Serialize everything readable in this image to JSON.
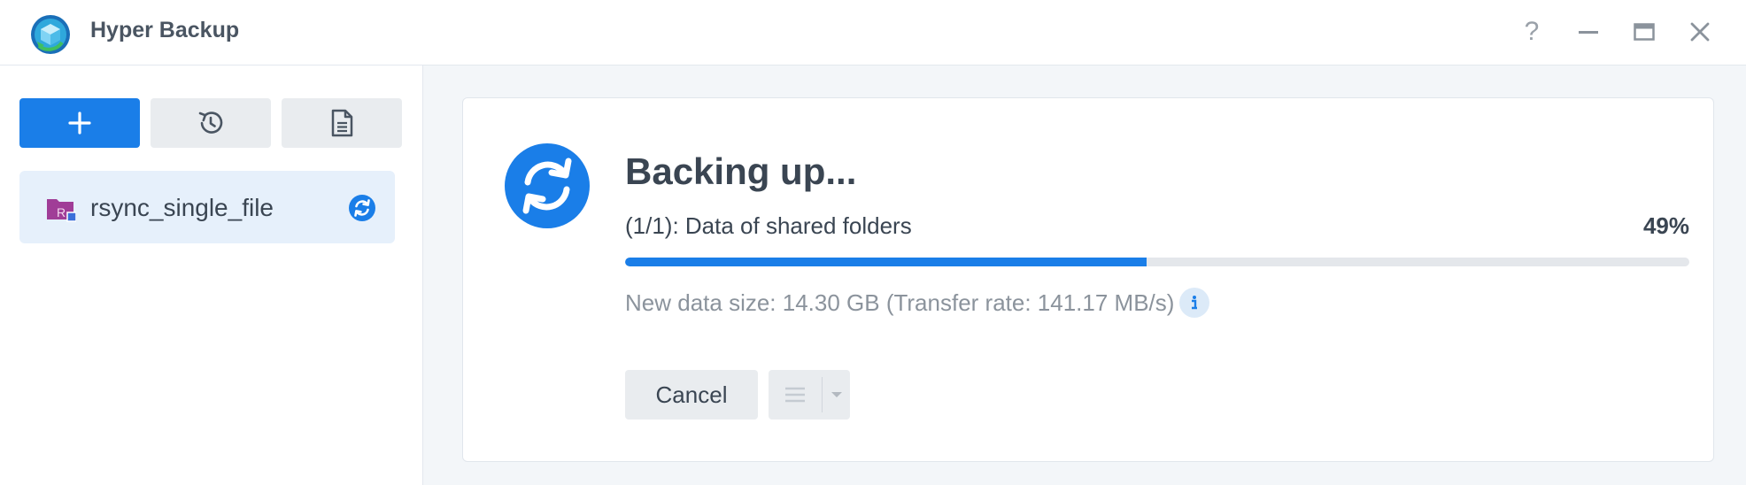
{
  "window": {
    "title": "Hyper Backup",
    "help_label": "?"
  },
  "icons": {
    "app": "hyper-backup-logo-icon",
    "add": "plus-icon",
    "history": "restore-history-icon",
    "log": "log-document-icon",
    "task": "rsync-folder-icon",
    "task_status": "sync-running-icon",
    "status": "sync-arrows-icon",
    "info": "info-icon",
    "menu": "list-menu-icon",
    "caret": "caret-down-icon",
    "minimize": "minimize-icon",
    "maximize": "maximize-icon",
    "close": "close-icon"
  },
  "colors": {
    "accent": "#1a7ee8",
    "task_folder": "#a03d97"
  },
  "sidebar": {
    "tasks": [
      {
        "label": "rsync_single_file",
        "status": "backing-up"
      }
    ]
  },
  "main": {
    "heading": "Backing up...",
    "step": "(1/1): Data of shared folders",
    "percent_label": "49%",
    "progress": 0.49,
    "detail": "New data size: 14.30 GB (Transfer rate: 141.17 MB/s)",
    "cancel_label": "Cancel"
  }
}
